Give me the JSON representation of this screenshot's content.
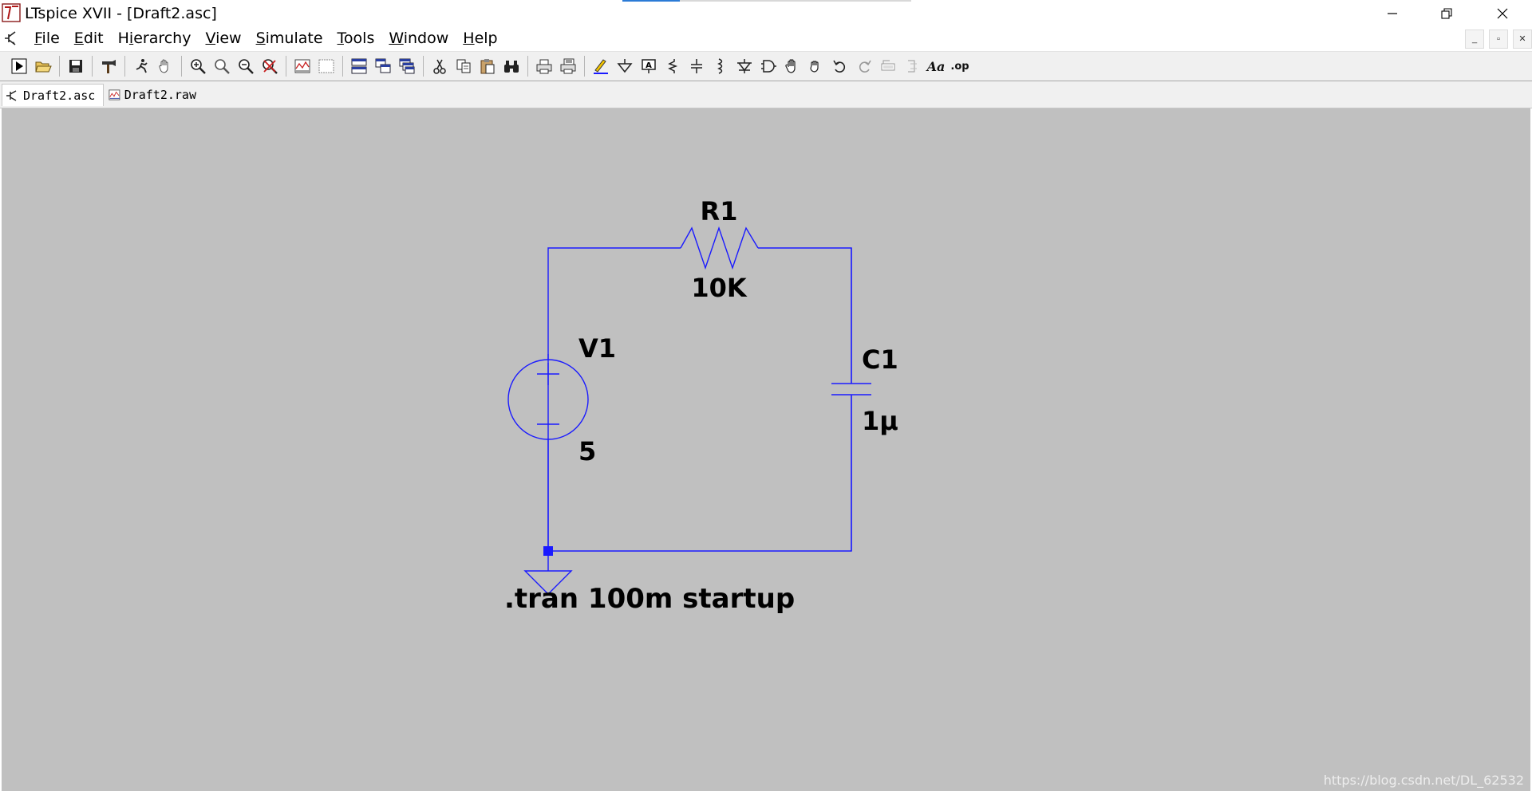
{
  "window": {
    "title": "LTspice XVII - [Draft2.asc]",
    "controls": {
      "minimize_icon": "minimize-icon",
      "restore_icon": "restore-icon",
      "close_icon": "close-icon"
    }
  },
  "menu": {
    "items": [
      {
        "label": "File",
        "accel": "F",
        "rest": "ile"
      },
      {
        "label": "Edit",
        "accel": "E",
        "rest": "dit"
      },
      {
        "label": "Hierarchy",
        "accel": "i",
        "pre": "H",
        "rest": "erarchy"
      },
      {
        "label": "View",
        "accel": "V",
        "rest": "iew"
      },
      {
        "label": "Simulate",
        "accel": "S",
        "rest": "imulate"
      },
      {
        "label": "Tools",
        "accel": "T",
        "rest": "ools"
      },
      {
        "label": "Window",
        "accel": "W",
        "rest": "indow"
      },
      {
        "label": "Help",
        "accel": "H",
        "rest": "elp"
      }
    ],
    "mdi_controls": [
      "_",
      "▫",
      "✕"
    ]
  },
  "toolbar": {
    "text_tool_label": "Aa",
    "op_tool_label": ".op"
  },
  "tabs": [
    {
      "label": "Draft2.asc",
      "active": true
    },
    {
      "label": "Draft2.raw",
      "active": false
    }
  ],
  "schematic": {
    "wire_color": "#1a1aff",
    "components": {
      "r1": {
        "name": "R1",
        "value": "10K"
      },
      "v1": {
        "name": "V1",
        "value": "5"
      },
      "c1": {
        "name": "C1",
        "value": "1μ"
      }
    },
    "directive": ".tran 100m startup"
  },
  "watermark": "https://blog.csdn.net/DL_62532"
}
